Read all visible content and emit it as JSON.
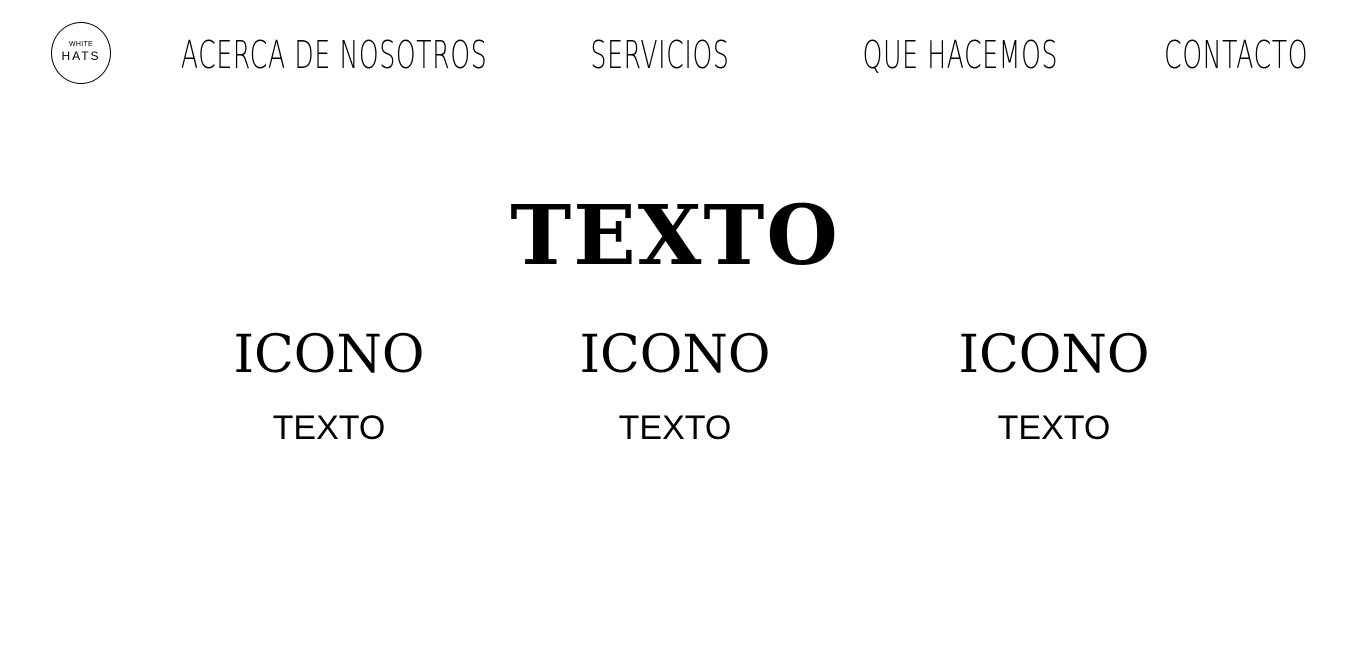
{
  "header": {
    "logo": {
      "top_text": "WHITE",
      "bottom_text": "HATS"
    },
    "nav": [
      {
        "label": "ACERCA DE NOSOTROS"
      },
      {
        "label": "SERVICIOS"
      },
      {
        "label": "QUE HACEMOS"
      },
      {
        "label": "CONTACTO"
      }
    ]
  },
  "main": {
    "title": "TEXTO",
    "features": [
      {
        "icon": "ICONO",
        "text": "TEXTO"
      },
      {
        "icon": "ICONO",
        "text": "TEXTO"
      },
      {
        "icon": "ICONO",
        "text": "TEXTO"
      }
    ]
  }
}
